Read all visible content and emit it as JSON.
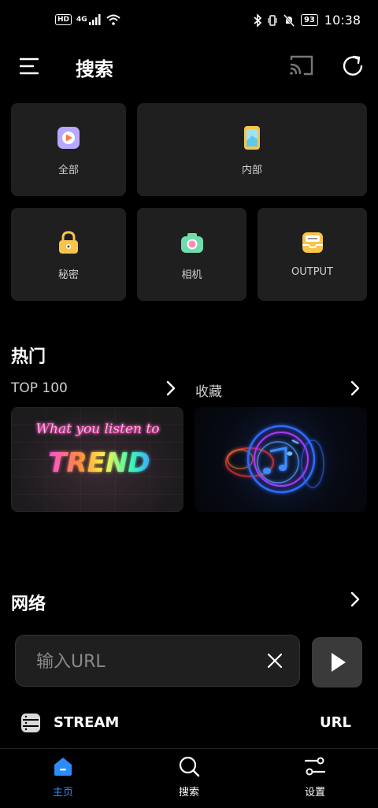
{
  "status_bar": {
    "hd": "HD",
    "network": "4G",
    "battery": "93",
    "time": "10:38"
  },
  "header": {
    "title": "搜索"
  },
  "categories": [
    {
      "label": "全部",
      "icon": "video-play-icon"
    },
    {
      "label": "内部",
      "icon": "phone-icon"
    },
    {
      "label": "秘密",
      "icon": "lock-icon"
    },
    {
      "label": "相机",
      "icon": "camera-icon"
    },
    {
      "label": "OUTPUT",
      "icon": "tray-icon"
    }
  ],
  "hot": {
    "title": "热门",
    "top100_label": "TOP 100",
    "favorites_label": "收藏",
    "card1_line1": "What you listen to",
    "card1_line2": "TREND"
  },
  "network": {
    "title": "网络",
    "url_placeholder": "输入URL",
    "stream_label": "STREAM",
    "url_label": "URL"
  },
  "bottom_nav": [
    {
      "label": "主页",
      "active": true
    },
    {
      "label": "搜索",
      "active": false
    },
    {
      "label": "设置",
      "active": false
    }
  ],
  "colors": {
    "accent": "#2b8bff",
    "tile_bg": "#1f1f1f",
    "background": "#000000"
  }
}
